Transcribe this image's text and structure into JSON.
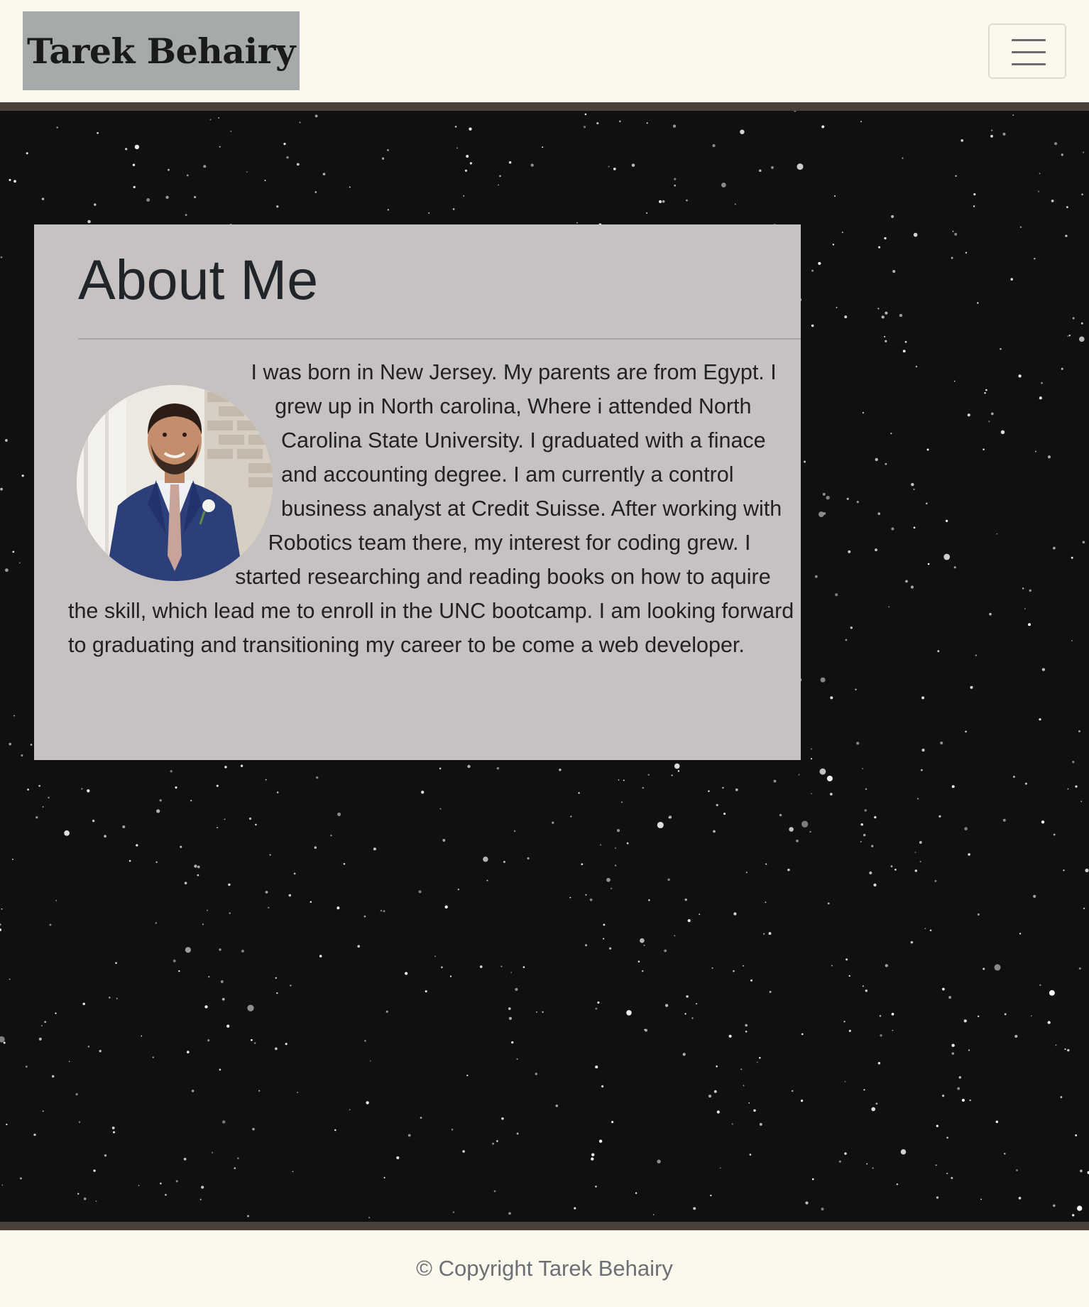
{
  "header": {
    "brand": "Tarek Behairy",
    "menu_icon": "hamburger-icon"
  },
  "about": {
    "title": "About Me",
    "photo_icon": "profile-photo",
    "bio": "I was born in New Jersey. My parents are from Egypt. I grew up in North carolina, Where i attended North Carolina State University. I graduated with a finace and accounting degree. I am currently a control business analyst at Credit Suisse. After working with Robotics team there, my interest for coding grew. I started researching and reading books on how to aquire the skill, which lead me to enroll in the UNC bootcamp. I am looking forward to graduating and transitioning my career to be come a web developer."
  },
  "footer": {
    "copyright": "© Copyright Tarek Behairy"
  },
  "colors": {
    "page_background": "#fbf9ee",
    "brand_background": "#a6aaab",
    "rule": "#4a413a",
    "space": "#111010",
    "card": "#c6c2c2",
    "text": "#212529"
  }
}
